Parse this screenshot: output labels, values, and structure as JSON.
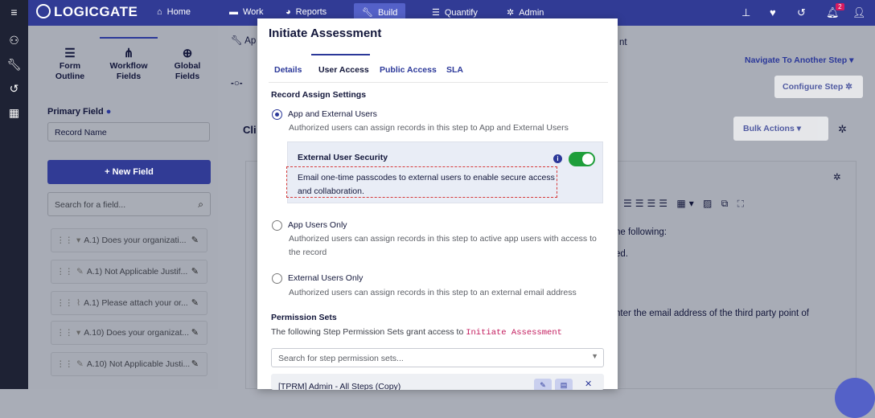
{
  "rail": {
    "icons": [
      "menu-icon",
      "org-icon",
      "wrench-icon",
      "history-icon",
      "grid-icon"
    ]
  },
  "topnav": {
    "logo": "LOGICGATE",
    "items": [
      {
        "icon": "home-icon",
        "label": "Home"
      },
      {
        "icon": "folder-icon",
        "label": "Work"
      },
      {
        "icon": "chart-icon",
        "label": "Reports"
      },
      {
        "icon": "wrench-icon",
        "label": "Build"
      },
      {
        "icon": "quantify-icon",
        "label": "Quantify"
      },
      {
        "icon": "gear-icon",
        "label": "Admin"
      }
    ],
    "right_icons": [
      "pin-icon",
      "heart-icon",
      "history-icon",
      "bell-icon",
      "user-icon"
    ],
    "notification_count": "2"
  },
  "left_panel": {
    "tabs": [
      {
        "icon": "form-icon",
        "label1": "Form",
        "label2": "Outline"
      },
      {
        "icon": "workflow-icon",
        "label1": "Workflow",
        "label2": "Fields"
      },
      {
        "icon": "globe-icon",
        "label1": "Global",
        "label2": "Fields"
      }
    ],
    "primary_field_label": "Primary Field",
    "primary_field_value": "Record Name",
    "new_field_label": "New Field",
    "search_placeholder": "Search for a field...",
    "fields": [
      "A.1) Does your organizati...",
      "A.1) Not Applicable Justif...",
      "A.1) Please attach your or...",
      "A.10) Does your organizat...",
      "A.10) Not Applicable Justi..."
    ]
  },
  "background": {
    "breadcrumb_fragment_1": "Ap",
    "breadcrumb_fragment_2": "nt",
    "navigate_step": "Navigate To Another Step",
    "configure_step": "Configure Step",
    "bulk_actions": "Bulk Actions",
    "section_fragment": "Cli",
    "text_lines": [
      "ne following:",
      "ed.",
      "nter the email address of the third party point of"
    ]
  },
  "modal": {
    "title": "Initiate Assessment",
    "tabs": [
      "Details",
      "User Access",
      "Public Access",
      "SLA"
    ],
    "active_tab": "User Access",
    "record_assign_heading": "Record Assign Settings",
    "options": [
      {
        "label": "App and External Users",
        "desc": "Authorized users can assign records in this step to App and External Users",
        "selected": true
      },
      {
        "label": "App Users Only",
        "desc": "Authorized users can assign records in this step to active app users with access to the record",
        "selected": false
      },
      {
        "label": "External Users Only",
        "desc": "Authorized users can assign records in this step to an external email address",
        "selected": false
      }
    ],
    "external_security": {
      "title": "External User Security",
      "desc": "Email one-time passcodes to external users to enable secure access and collaboration.",
      "enabled": true,
      "toggle_color": "#1e9e3a"
    },
    "permission_heading": "Permission Sets",
    "permission_desc": "The following Step Permission Sets grant access to",
    "permission_step": "Initiate Assessment",
    "permission_search_placeholder": "Search for step permission sets...",
    "permission_row": "[TPRM] Admin - All Steps (Copy)"
  },
  "colors": {
    "brand": "#313b95",
    "accent": "#2b3899",
    "highlight_dash": "#d63a3a"
  }
}
